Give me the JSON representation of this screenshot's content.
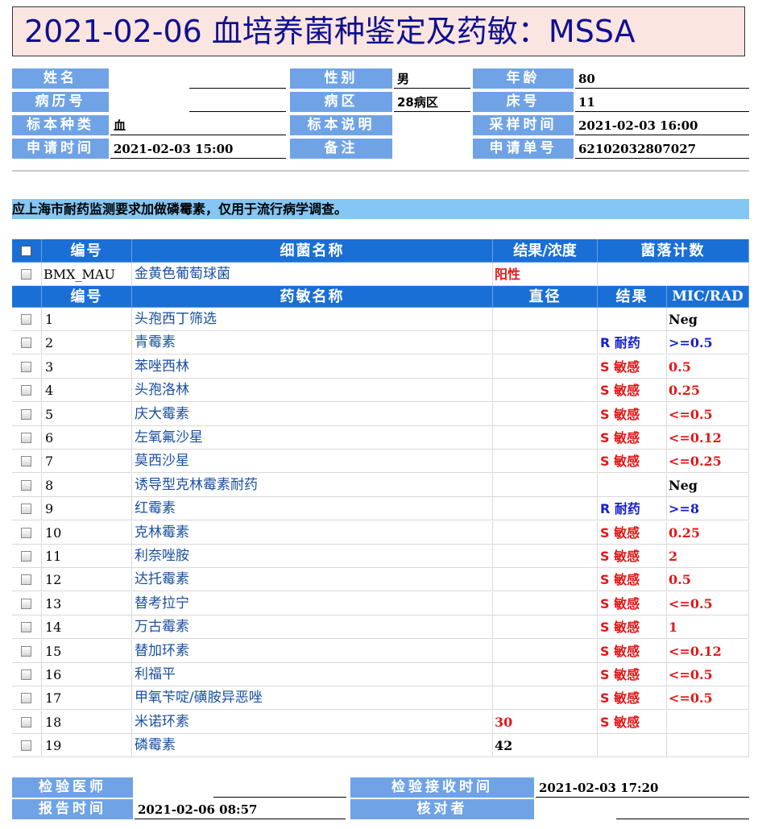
{
  "title": "2021-02-06 血培养菌种鉴定及药敏：MSSA",
  "info": [
    [
      {
        "label": "姓名",
        "value": ""
      },
      {
        "label": "性别",
        "value": "男"
      },
      {
        "label": "年龄",
        "value": "80"
      }
    ],
    [
      {
        "label": "病历号",
        "value": ""
      },
      {
        "label": "病区",
        "value": "28病区"
      },
      {
        "label": "床号",
        "value": "11"
      }
    ],
    [
      {
        "label": "标本种类",
        "value": "血"
      },
      {
        "label": "标本说明",
        "value": ""
      },
      {
        "label": "采样时间",
        "value": "2021-02-03 16:00"
      }
    ],
    [
      {
        "label": "申请时间",
        "value": "2021-02-03 15:00"
      },
      {
        "label": "备注",
        "value": ""
      },
      {
        "label": "申请单号",
        "value": "62102032807027"
      }
    ]
  ],
  "notice": "应上海市耐药监测要求加做磷霉素，仅用于流行病学调查。",
  "bacteria_header": {
    "id": "编号",
    "name": "细菌名称",
    "result": "结果/浓度",
    "count": "菌落计数"
  },
  "bacteria": {
    "id": "BMX_MAU",
    "name": "金黄色葡萄球菌",
    "result": "阳性",
    "count": ""
  },
  "drug_header": {
    "id": "编号",
    "name": "药敏名称",
    "diameter": "直径",
    "result": "结果",
    "mic": "MIC/RAD"
  },
  "drugs": [
    {
      "id": "1",
      "name": "头孢西丁筛选",
      "diameter": "",
      "result": "",
      "mic": "Neg",
      "color": "black"
    },
    {
      "id": "2",
      "name": "青霉素",
      "diameter": "",
      "result": "R 耐药",
      "mic": ">=0.5",
      "color": "blue"
    },
    {
      "id": "3",
      "name": "苯唑西林",
      "diameter": "",
      "result": "S 敏感",
      "mic": "0.5",
      "color": "red"
    },
    {
      "id": "4",
      "name": "头孢洛林",
      "diameter": "",
      "result": "S 敏感",
      "mic": "0.25",
      "color": "red"
    },
    {
      "id": "5",
      "name": "庆大霉素",
      "diameter": "",
      "result": "S 敏感",
      "mic": "<=0.5",
      "color": "red"
    },
    {
      "id": "6",
      "name": "左氧氟沙星",
      "diameter": "",
      "result": "S 敏感",
      "mic": "<=0.12",
      "color": "red"
    },
    {
      "id": "7",
      "name": "莫西沙星",
      "diameter": "",
      "result": "S 敏感",
      "mic": "<=0.25",
      "color": "red"
    },
    {
      "id": "8",
      "name": "诱导型克林霉素耐药",
      "diameter": "",
      "result": "",
      "mic": "Neg",
      "color": "black"
    },
    {
      "id": "9",
      "name": "红霉素",
      "diameter": "",
      "result": "R 耐药",
      "mic": ">=8",
      "color": "blue"
    },
    {
      "id": "10",
      "name": "克林霉素",
      "diameter": "",
      "result": "S 敏感",
      "mic": "0.25",
      "color": "red"
    },
    {
      "id": "11",
      "name": "利奈唑胺",
      "diameter": "",
      "result": "S 敏感",
      "mic": "2",
      "color": "red"
    },
    {
      "id": "12",
      "name": "达托霉素",
      "diameter": "",
      "result": "S 敏感",
      "mic": "0.5",
      "color": "red"
    },
    {
      "id": "13",
      "name": "替考拉宁",
      "diameter": "",
      "result": "S 敏感",
      "mic": "<=0.5",
      "color": "red"
    },
    {
      "id": "14",
      "name": "万古霉素",
      "diameter": "",
      "result": "S 敏感",
      "mic": "1",
      "color": "red"
    },
    {
      "id": "15",
      "name": "替加环素",
      "diameter": "",
      "result": "S 敏感",
      "mic": "<=0.12",
      "color": "red"
    },
    {
      "id": "16",
      "name": "利福平",
      "diameter": "",
      "result": "S 敏感",
      "mic": "<=0.5",
      "color": "red"
    },
    {
      "id": "17",
      "name": "甲氧苄啶/磺胺异恶唑",
      "diameter": "",
      "result": "S 敏感",
      "mic": "<=0.5",
      "color": "red"
    },
    {
      "id": "18",
      "name": "米诺环素",
      "diameter": "30",
      "result": "S 敏感",
      "mic": "",
      "color": "red",
      "diameter_color": "red"
    },
    {
      "id": "19",
      "name": "磷霉素",
      "diameter": "42",
      "result": "",
      "mic": "",
      "color": "black",
      "diameter_color": "black"
    }
  ],
  "footer": [
    [
      {
        "label": "检验医师",
        "value": ""
      },
      {
        "label": "检验接收时间",
        "value": "2021-02-03 17:20"
      }
    ],
    [
      {
        "label": "报告时间",
        "value": "2021-02-06 08:57"
      },
      {
        "label": "核对者",
        "value": ""
      }
    ]
  ]
}
